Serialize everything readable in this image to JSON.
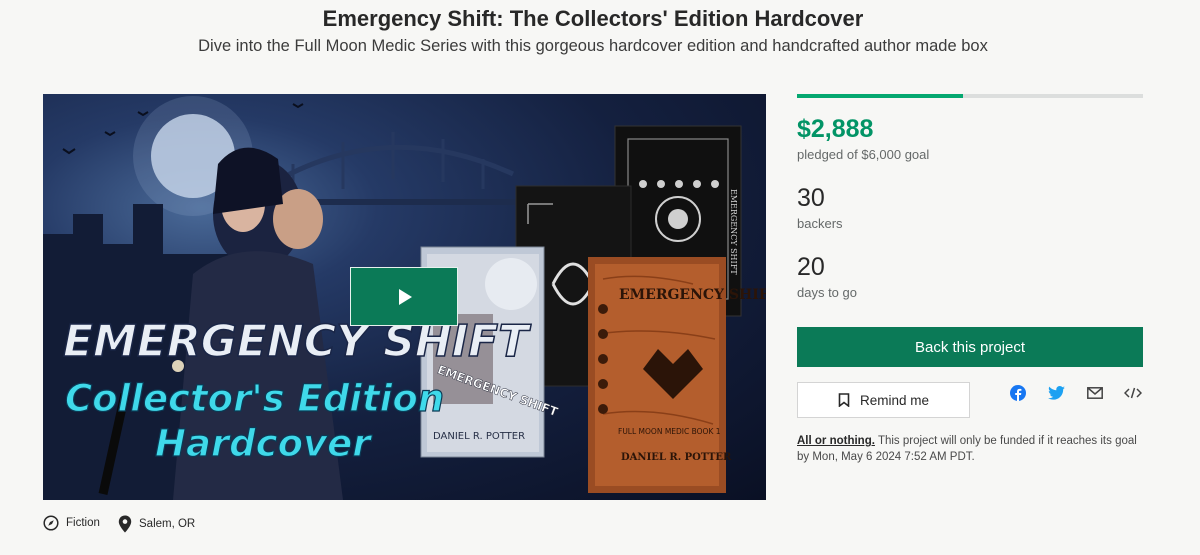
{
  "project": {
    "title": "Emergency Shift: The Collectors' Edition Hardcover",
    "subtitle": "Dive into the Full Moon Medic Series with this gorgeous hardcover edition and handcrafted author made box"
  },
  "media": {
    "cover_title_line1": "EMERGENCY SHIFT",
    "cover_title_line2": "Collector's Edition",
    "cover_title_line3": "Hardcover",
    "book_title": "EMERGENCY SHIFT",
    "book_series": "FULL MOON MEDIC BOOK 1",
    "book_author": "DANIEL R. POTTER",
    "spine_text": "EMERGENCY SHIFT"
  },
  "funding": {
    "progress_fraction": 0.48,
    "pledged": "$2,888",
    "pledged_sub": "pledged of $6,000 goal",
    "backers": "30",
    "backers_label": "backers",
    "days": "20",
    "days_label": "days to go"
  },
  "actions": {
    "back_label": "Back this project",
    "remind_label": "Remind me"
  },
  "share_icons": [
    "facebook-icon",
    "twitter-icon",
    "email-icon",
    "embed-icon"
  ],
  "colors": {
    "accent": "#0b7a57",
    "pledged": "#029466",
    "progress": "#05a870",
    "facebook": "#1877f2",
    "twitter": "#1da1f2"
  },
  "fine_print": {
    "all_or_nothing": "All or nothing.",
    "body": "This project will only be funded if it reaches its goal by Mon, May 6 2024 7:52 AM PDT."
  },
  "meta": {
    "category": "Fiction",
    "location": "Salem, OR"
  }
}
